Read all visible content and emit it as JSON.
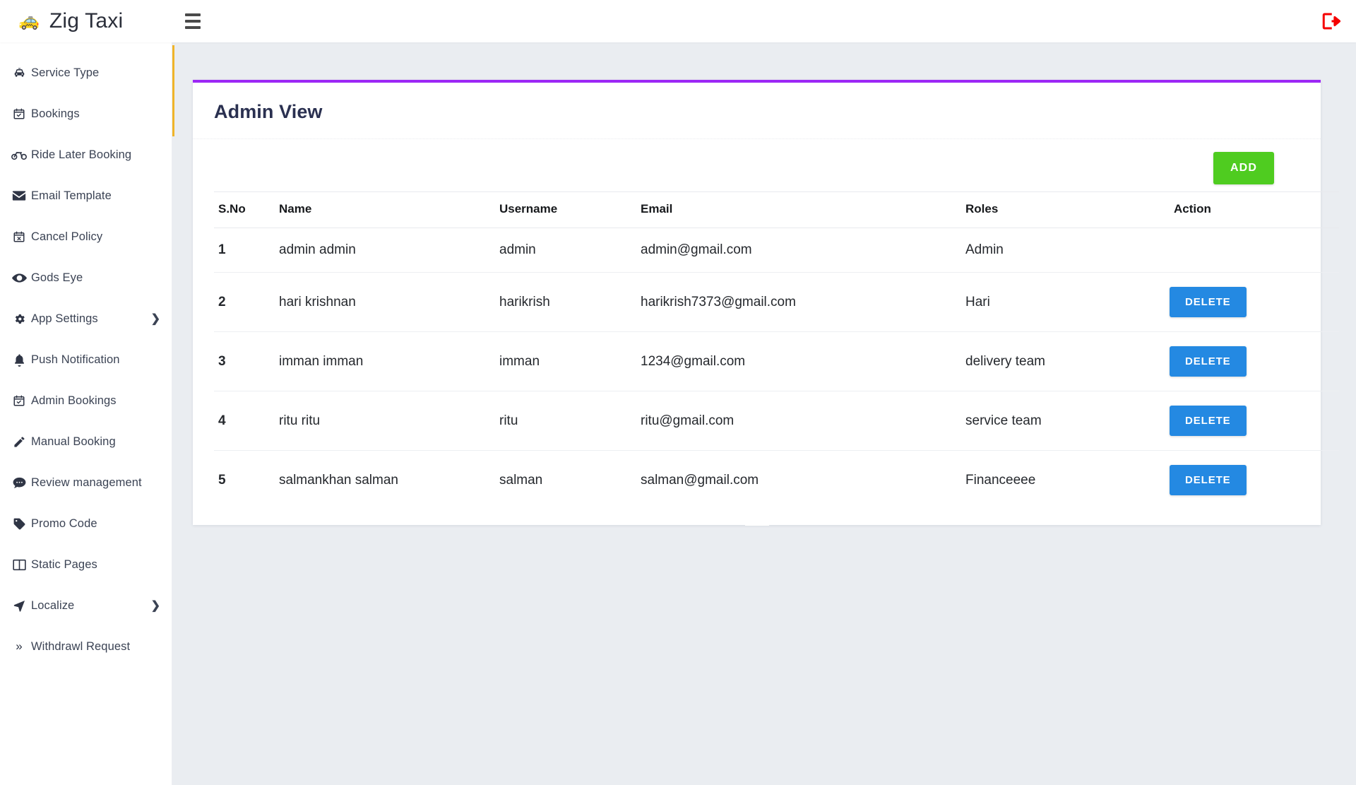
{
  "header": {
    "brand_icon": "taxi-icon",
    "brand_title": "Zig Taxi",
    "menu_toggle_icon": "hamburger-icon",
    "logout_icon": "logout-icon",
    "accent_color": "#f0b429"
  },
  "sidebar": {
    "items": [
      {
        "label": "Service Type",
        "icon": "taxi-icon",
        "has_chevron": false
      },
      {
        "label": "Bookings",
        "icon": "calendar-check-icon",
        "has_chevron": false
      },
      {
        "label": "Ride Later Booking",
        "icon": "bicycle-icon",
        "has_chevron": false
      },
      {
        "label": "Email Template",
        "icon": "envelope-icon",
        "has_chevron": false
      },
      {
        "label": "Cancel Policy",
        "icon": "calendar-x-icon",
        "has_chevron": false
      },
      {
        "label": "Gods Eye",
        "icon": "eye-icon",
        "has_chevron": false
      },
      {
        "label": "App Settings",
        "icon": "gear-icon",
        "has_chevron": true
      },
      {
        "label": "Push Notification",
        "icon": "bell-icon",
        "has_chevron": false
      },
      {
        "label": "Admin Bookings",
        "icon": "calendar-check-icon",
        "has_chevron": false
      },
      {
        "label": "Manual Booking",
        "icon": "pencil-icon",
        "has_chevron": false
      },
      {
        "label": "Review management",
        "icon": "comment-icon",
        "has_chevron": false
      },
      {
        "label": "Promo Code",
        "icon": "tag-icon",
        "has_chevron": false
      },
      {
        "label": "Static Pages",
        "icon": "columns-icon",
        "has_chevron": false
      },
      {
        "label": "Localize",
        "icon": "location-arrow-icon",
        "has_chevron": true
      },
      {
        "label": "Withdrawl Request",
        "icon": "angle-double-right-icon",
        "has_chevron": false
      }
    ]
  },
  "main": {
    "card_title": "Admin View",
    "card_accent_color": "#9c27f5",
    "add_button_label": "ADD",
    "add_button_color": "#4fcc20",
    "delete_button_color": "#2489e2",
    "table": {
      "columns": [
        "S.No",
        "Name",
        "Username",
        "Email",
        "Roles",
        "Action"
      ],
      "rows": [
        {
          "sno": "1",
          "name": "admin admin",
          "username": "admin",
          "email": "admin@gmail.com",
          "roles": "Admin",
          "action": ""
        },
        {
          "sno": "2",
          "name": "hari krishnan",
          "username": "harikrish",
          "email": "harikrish7373@gmail.com",
          "roles": "Hari",
          "action": "DELETE"
        },
        {
          "sno": "3",
          "name": "imman imman",
          "username": "imman",
          "email": "1234@gmail.com",
          "roles": "delivery team",
          "action": "DELETE"
        },
        {
          "sno": "4",
          "name": "ritu ritu",
          "username": "ritu",
          "email": "ritu@gmail.com",
          "roles": "service team",
          "action": "DELETE"
        },
        {
          "sno": "5",
          "name": "salmankhan salman",
          "username": "salman",
          "email": "salman@gmail.com",
          "roles": "Financeeee",
          "action": "DELETE"
        }
      ]
    }
  }
}
